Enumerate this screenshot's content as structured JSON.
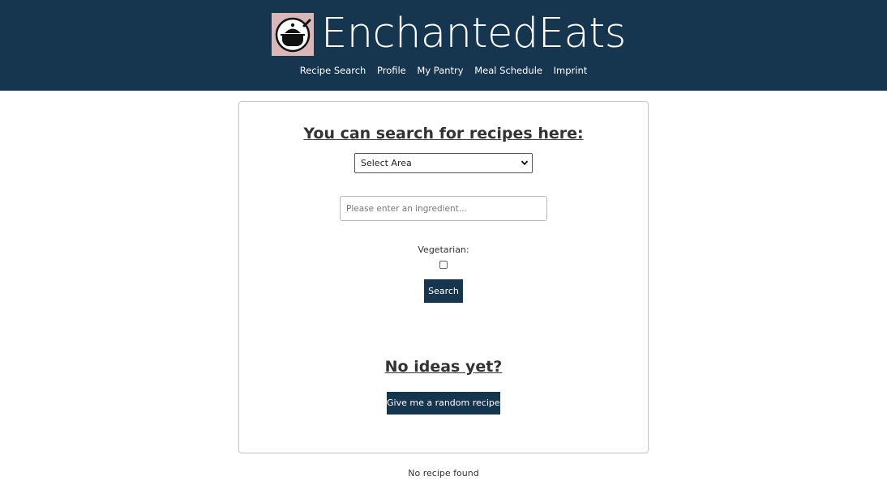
{
  "header": {
    "brand": "EnchantedEats",
    "logo_icon": "cooking-pot-icon",
    "nav": [
      "Recipe Search",
      "Profile",
      "My Pantry",
      "Meal Schedule",
      "Imprint"
    ]
  },
  "search": {
    "title": "You can search for recipes here:",
    "area_select": "Select Area",
    "ingredient_placeholder": "Please enter an ingredient...",
    "vegetarian_label": "Vegetarian:",
    "vegetarian_checked": false,
    "search_button": "Search"
  },
  "random": {
    "title": "No ideas yet?",
    "button": "Give me a random recipe!"
  },
  "result_message": "No recipe found",
  "colors": {
    "header_bg": "#16354f",
    "logo_bg": "#d9b7b9",
    "button_bg": "#16354f"
  }
}
